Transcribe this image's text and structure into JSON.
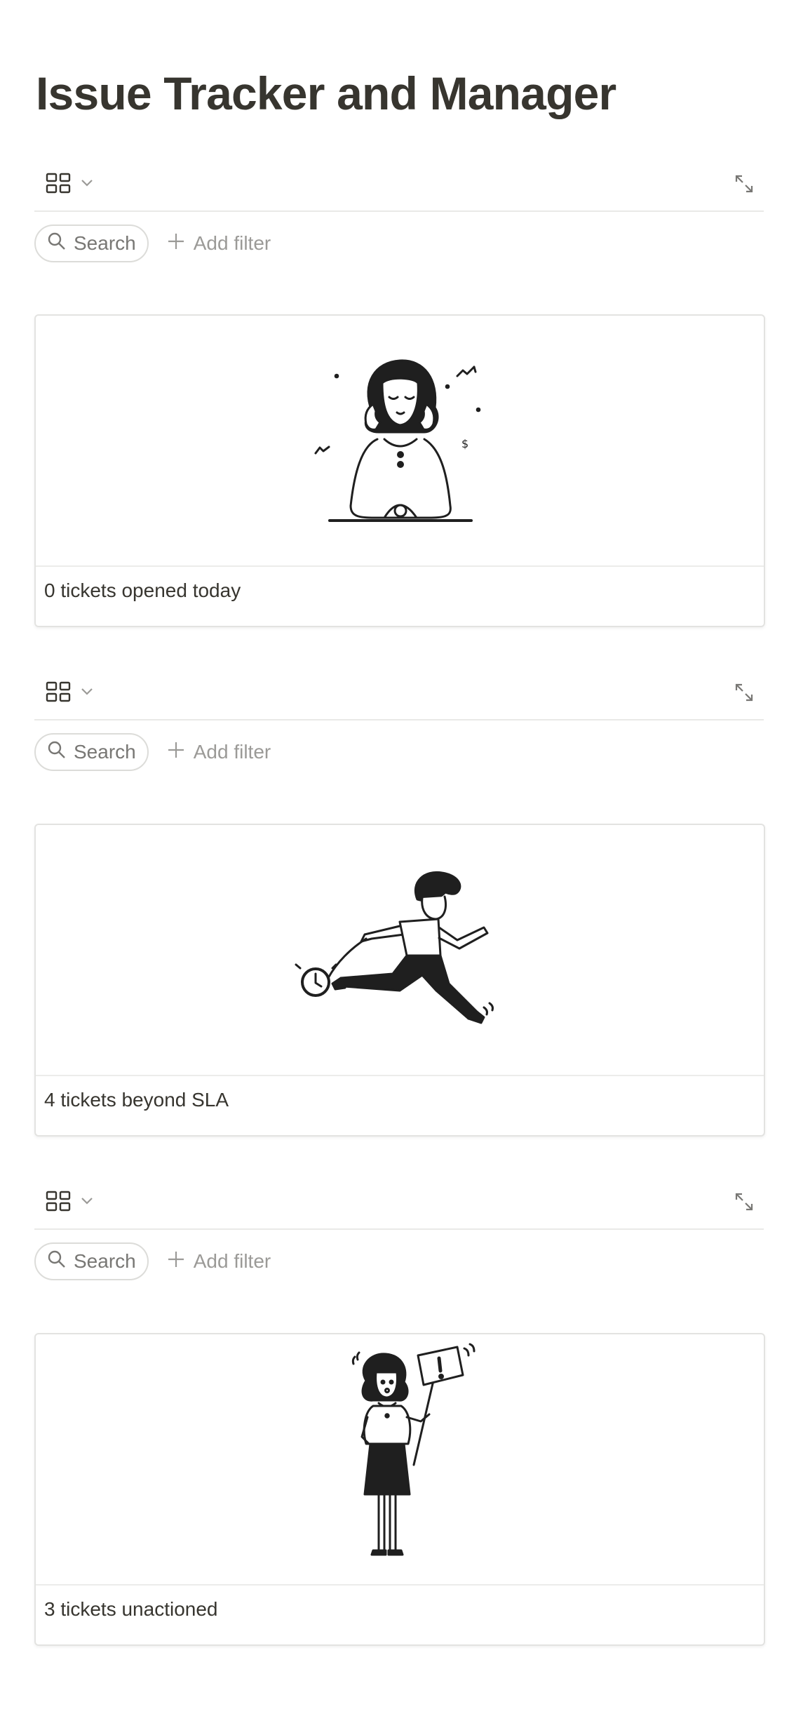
{
  "page": {
    "title": "Issue Tracker and Manager"
  },
  "colors": {
    "text": "#37352f",
    "muted": "#787774",
    "border": "#e9e9e7"
  },
  "views": [
    {
      "view_icon": "gallery-grid-icon",
      "search_label": "Search",
      "add_filter_label": "Add filter",
      "card": {
        "illustration": "woman-on-two-phones-illustration",
        "title": "0 tickets opened today"
      }
    },
    {
      "view_icon": "gallery-grid-icon",
      "search_label": "Search",
      "add_filter_label": "Add filter",
      "card": {
        "illustration": "man-running-with-clock-illustration",
        "title": "4 tickets beyond SLA"
      }
    },
    {
      "view_icon": "gallery-grid-icon",
      "search_label": "Search",
      "add_filter_label": "Add filter",
      "card": {
        "illustration": "woman-holding-warning-sign-illustration",
        "title": "3 tickets unactioned"
      }
    }
  ]
}
